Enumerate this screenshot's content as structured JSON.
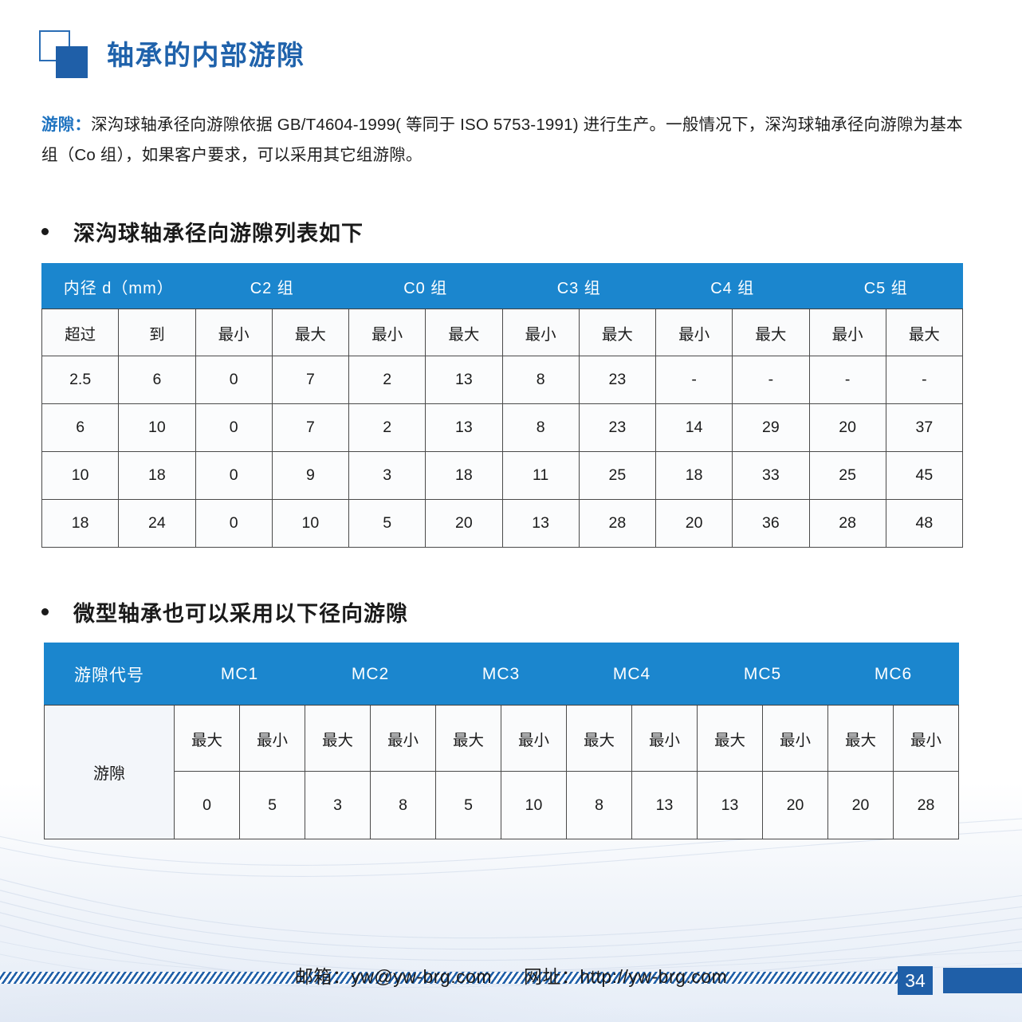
{
  "document": {
    "title": "轴承的内部游隙",
    "icon": "two-squares-icon"
  },
  "intro": {
    "lead_label": "游隙：",
    "body": "深沟球轴承径向游隙依据 GB/T4604-1999( 等同于 ISO 5753-1991) 进行生产。一般情况下，深沟球轴承径向游隙为基本组（Co 组），如果客户要求，可以采用其它组游隙。"
  },
  "sections": [
    {
      "id": "sec1",
      "heading": "深沟球轴承径向游隙列表如下"
    },
    {
      "id": "sec2",
      "heading": "微型轴承也可以采用以下径向游隙"
    }
  ],
  "table_clearance": {
    "group_headers": [
      "内径 d（mm）",
      "C2 组",
      "C0 组",
      "C3 组",
      "C4 组",
      "C5 组"
    ],
    "sub_headers": [
      "超过",
      "到",
      "最小",
      "最大",
      "最小",
      "最大",
      "最小",
      "最大",
      "最小",
      "最大",
      "最小",
      "最大"
    ],
    "rows": [
      [
        "2.5",
        "6",
        "0",
        "7",
        "2",
        "13",
        "8",
        "23",
        "-",
        "-",
        "-",
        "-"
      ],
      [
        "6",
        "10",
        "0",
        "7",
        "2",
        "13",
        "8",
        "23",
        "14",
        "29",
        "20",
        "37"
      ],
      [
        "10",
        "18",
        "0",
        "9",
        "3",
        "18",
        "11",
        "25",
        "18",
        "33",
        "25",
        "45"
      ],
      [
        "18",
        "24",
        "0",
        "10",
        "5",
        "20",
        "13",
        "28",
        "20",
        "36",
        "28",
        "48"
      ]
    ]
  },
  "table_micro": {
    "group_headers": [
      "游隙代号",
      "MC1",
      "MC2",
      "MC3",
      "MC4",
      "MC5",
      "MC6"
    ],
    "row_label": "游隙",
    "sub_headers": [
      "最大",
      "最小",
      "最大",
      "最小",
      "最大",
      "最小",
      "最大",
      "最小",
      "最大",
      "最小",
      "最大",
      "最小"
    ],
    "values": [
      "0",
      "5",
      "3",
      "8",
      "5",
      "10",
      "8",
      "13",
      "13",
      "20",
      "20",
      "28"
    ]
  },
  "footer": {
    "email_label": "邮箱：yw@yw-brg.com",
    "website_label": "网址：http://yw-brg.com",
    "page_number": "34"
  },
  "colors": {
    "table_header_blue": "#1b86ce",
    "brand_dark_blue": "#1f5fa8",
    "title_blue": "#1f62ab",
    "lead_blue": "#1f73c0"
  }
}
